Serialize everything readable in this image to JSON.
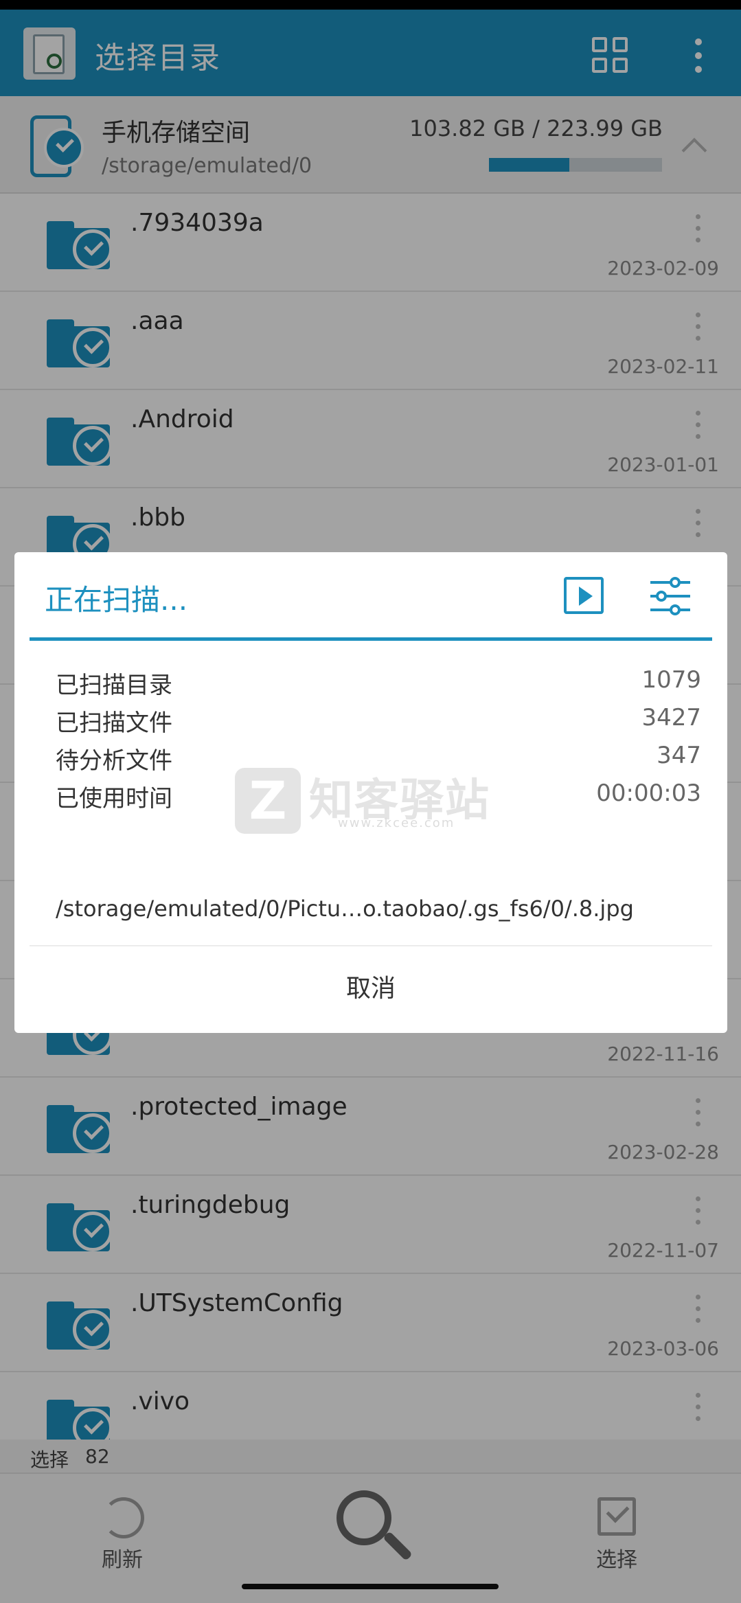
{
  "header": {
    "title": "选择目录",
    "icons": [
      "app-icon",
      "grid-view-icon",
      "more-vert-icon"
    ]
  },
  "storage": {
    "title": "手机存储空间",
    "path": "/storage/emulated/0",
    "size": "103.82 GB / 223.99 GB",
    "used_fraction": 0.4635
  },
  "folders": [
    {
      "name": ".7934039a",
      "date": "2023-02-09"
    },
    {
      "name": ".aaa",
      "date": "2023-02-11"
    },
    {
      "name": ".Android",
      "date": "2023-01-01"
    },
    {
      "name": ".bbb",
      "date": ""
    },
    {
      "name": "",
      "date": ""
    },
    {
      "name": "",
      "date": ""
    },
    {
      "name": "",
      "date": ""
    },
    {
      "name": "",
      "date": ""
    },
    {
      "name": "",
      "date": "2022-11-16"
    },
    {
      "name": ".protected_image",
      "date": "2023-02-28"
    },
    {
      "name": ".turingdebug",
      "date": "2022-11-07"
    },
    {
      "name": ".UTSystemConfig",
      "date": "2023-03-06"
    },
    {
      "name": ".vivo",
      "date": ""
    }
  ],
  "selection": {
    "label": "选择",
    "count": "82"
  },
  "bottom": {
    "refresh_label": "刷新",
    "select_label": "选择"
  },
  "dialog": {
    "title": "正在扫描...",
    "stats": [
      {
        "label": "已扫描目录",
        "value": "1079"
      },
      {
        "label": "已扫描文件",
        "value": "3427"
      },
      {
        "label": "待分析文件",
        "value": "347"
      },
      {
        "label": "已使用时间",
        "value": "00:00:03"
      }
    ],
    "current_path": "/storage/emulated/0/Pictu…o.taobao/.gs_fs6/0/.8.jpg",
    "cancel_label": "取消"
  },
  "watermark": {
    "logo": "Z",
    "text": "知客驿站",
    "url": "www.zkcee.com"
  },
  "colors": {
    "accent": "#1d90bf",
    "overlay": "rgba(0,0,0,0.36)"
  }
}
